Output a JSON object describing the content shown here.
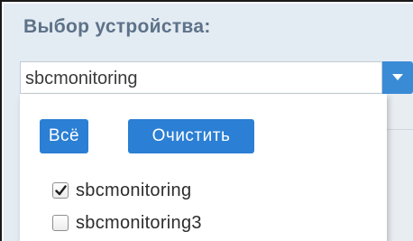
{
  "panel": {
    "title": "Выбор устройства:"
  },
  "select": {
    "value": "sbcmonitoring",
    "arrow_icon": "caret-down-icon"
  },
  "dropdown": {
    "buttons": {
      "all_label": "Всё",
      "clear_label": "Очистить"
    },
    "options": [
      {
        "label": "sbcmonitoring",
        "checked": true
      },
      {
        "label": "sbcmonitoring3",
        "checked": false
      }
    ]
  },
  "colors": {
    "accent": "#2b7fd4",
    "title": "#5d7288",
    "panel_bg": "#e3ebf3"
  }
}
